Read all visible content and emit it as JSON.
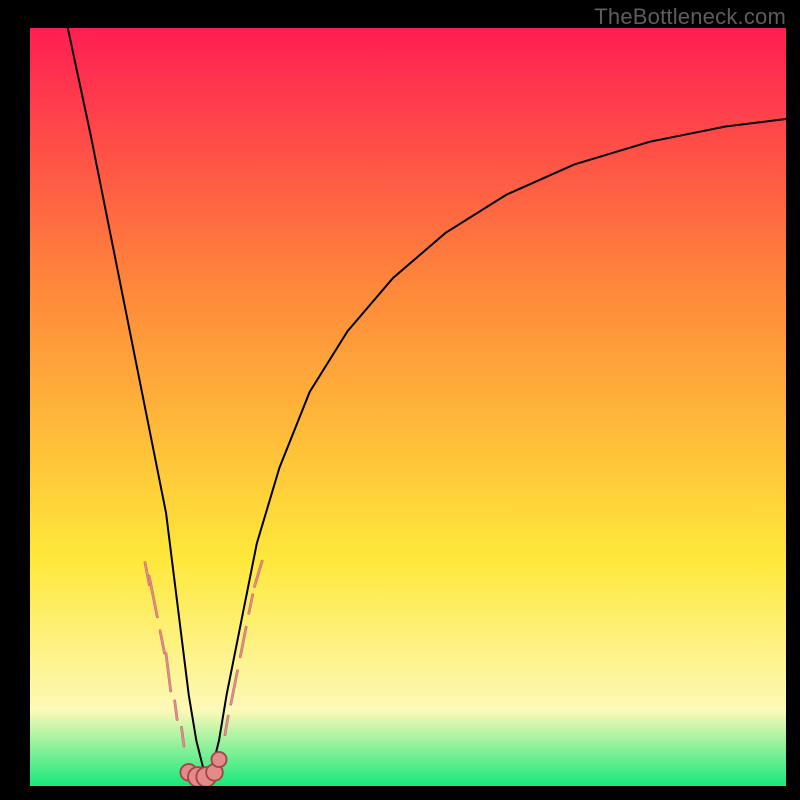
{
  "watermark": "TheBottleneck.com",
  "colors": {
    "gradient_top": "#ff1e53",
    "gradient_mid1": "#ff8a3a",
    "gradient_mid2": "#ffe83a",
    "gradient_pale": "#fdf9b8",
    "gradient_green": "#17e87a",
    "curve": "#000000",
    "marker_fill": "#e48a8a",
    "marker_stroke": "#a04848"
  },
  "chart_data": {
    "type": "line",
    "title": "",
    "xlabel": "",
    "ylabel": "",
    "xlim": [
      0,
      100
    ],
    "ylim": [
      0,
      100
    ],
    "legend": false,
    "grid": false,
    "description": "Bottleneck-style V curve: steep descent from top-left to a narrow minimum near x≈22, then a slow asymptotic rise toward the right. Background is a vertical red→orange→yellow→pale→green gradient. Salmon pill-shaped markers cluster on both flanks of the V just above the minimum; a few sit on the green floor at the trough.",
    "series": [
      {
        "name": "bottleneck-curve",
        "x": [
          5,
          8,
          10,
          12,
          14,
          16,
          18,
          19,
          20,
          21,
          22,
          23,
          24,
          25,
          26,
          28,
          30,
          33,
          37,
          42,
          48,
          55,
          63,
          72,
          82,
          92,
          100
        ],
        "y": [
          100,
          86,
          76,
          66,
          56,
          46,
          36,
          28,
          20,
          12,
          6,
          2,
          2,
          6,
          12,
          22,
          32,
          42,
          52,
          60,
          67,
          73,
          78,
          82,
          85,
          87,
          88
        ]
      }
    ],
    "markers_left_flank": [
      {
        "x": 15.5,
        "y": 28.0,
        "len": 3.0
      },
      {
        "x": 16.3,
        "y": 25.0,
        "len": 5.5
      },
      {
        "x": 17.5,
        "y": 19.0,
        "len": 3.0
      },
      {
        "x": 18.3,
        "y": 15.0,
        "len": 5.0
      },
      {
        "x": 19.3,
        "y": 10.0,
        "len": 2.5
      },
      {
        "x": 20.2,
        "y": 6.5,
        "len": 2.5
      }
    ],
    "markers_right_flank": [
      {
        "x": 26.0,
        "y": 8.0,
        "len": 2.5
      },
      {
        "x": 27.0,
        "y": 13.0,
        "len": 4.5
      },
      {
        "x": 28.2,
        "y": 19.0,
        "len": 4.0
      },
      {
        "x": 29.2,
        "y": 24.0,
        "len": 2.5
      },
      {
        "x": 30.2,
        "y": 28.0,
        "len": 3.5
      }
    ],
    "markers_trough": [
      {
        "x": 21.0,
        "y": 1.8,
        "r": 1.1
      },
      {
        "x": 22.2,
        "y": 1.2,
        "r": 1.3
      },
      {
        "x": 23.3,
        "y": 1.2,
        "r": 1.3
      },
      {
        "x": 24.4,
        "y": 1.8,
        "r": 1.1
      },
      {
        "x": 25.0,
        "y": 3.5,
        "r": 1.0
      }
    ]
  }
}
